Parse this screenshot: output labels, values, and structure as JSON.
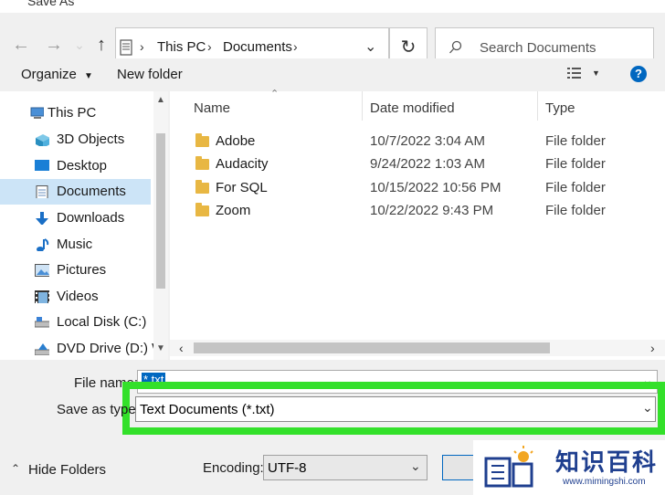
{
  "window": {
    "title": "Save As"
  },
  "nav": {
    "breadcrumb": [
      "This PC",
      "Documents"
    ],
    "search_placeholder": "Search Documents"
  },
  "toolbar": {
    "organize": "Organize",
    "new_folder": "New folder",
    "help": "?"
  },
  "sidebar": {
    "items": [
      {
        "label": "This PC",
        "icon": "pc-icon"
      },
      {
        "label": "3D Objects",
        "icon": "cube-icon"
      },
      {
        "label": "Desktop",
        "icon": "desktop-icon"
      },
      {
        "label": "Documents",
        "icon": "documents-icon",
        "selected": true
      },
      {
        "label": "Downloads",
        "icon": "download-icon"
      },
      {
        "label": "Music",
        "icon": "music-icon"
      },
      {
        "label": "Pictures",
        "icon": "pictures-icon"
      },
      {
        "label": "Videos",
        "icon": "videos-icon"
      },
      {
        "label": "Local Disk (C:)",
        "icon": "disk-icon"
      },
      {
        "label": "DVD Drive (D:) W",
        "icon": "dvd-icon"
      }
    ]
  },
  "files": {
    "columns": [
      "Name",
      "Date modified",
      "Type"
    ],
    "rows": [
      {
        "name": "Adobe",
        "date": "10/7/2022 3:04 AM",
        "type": "File folder"
      },
      {
        "name": "Audacity",
        "date": "9/24/2022 1:03 AM",
        "type": "File folder"
      },
      {
        "name": "For SQL",
        "date": "10/15/2022 10:56 PM",
        "type": "File folder"
      },
      {
        "name": "Zoom",
        "date": "10/22/2022 9:43 PM",
        "type": "File folder"
      }
    ]
  },
  "save": {
    "filename_label": "File name:",
    "filename_value": "*.txt",
    "type_label": "Save as type:",
    "type_value": "Text Documents (*.txt)",
    "encoding_label": "Encoding:",
    "encoding_value": "UTF-8",
    "hide_folders": "Hide Folders"
  },
  "watermark": {
    "text": "知识百科",
    "url": "www.mimingshi.com"
  },
  "colors": {
    "highlight": "#33e02a",
    "accent": "#0067c0",
    "selected": "#cce4f7"
  }
}
